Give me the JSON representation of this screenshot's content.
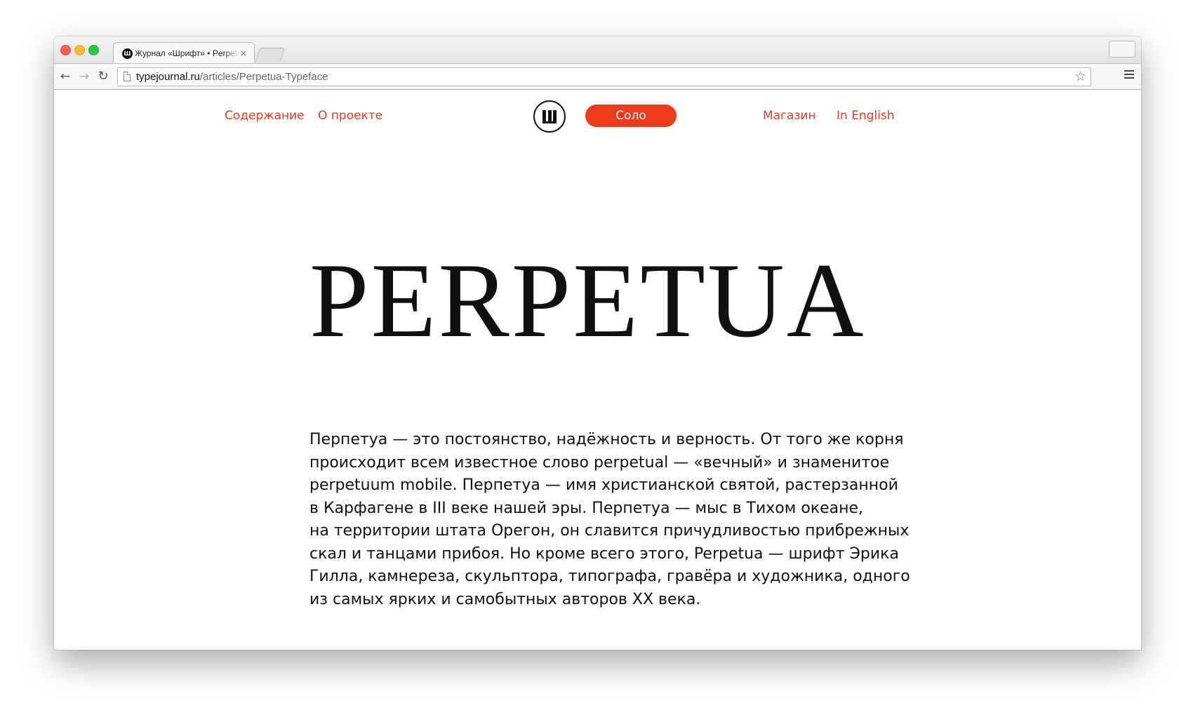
{
  "browser": {
    "tab": {
      "favicon_glyph": "Ш",
      "title": "Журнал «Шрифт» • Perpetua Typeface",
      "close_glyph": "×"
    },
    "nav": {
      "back_glyph": "←",
      "forward_glyph": "→",
      "reload_glyph": "↻"
    },
    "address": {
      "domain": "typejournal.ru",
      "path": "/articles/Perpetua-Typeface"
    },
    "bookmark_glyph": "☆",
    "icons": [
      "page-icon",
      "star-icon",
      "menu-icon",
      "back-icon",
      "forward-icon",
      "reload-icon",
      "close-icon"
    ],
    "traffic_colors": [
      "#fc5f57",
      "#fdbc2e",
      "#28c840"
    ]
  },
  "site": {
    "accent_color": "#ef3a1c",
    "nav_left": [
      "Содержание",
      "О проекте"
    ],
    "solo_label": "Соло",
    "nav_right": [
      "Магазин",
      "In English"
    ]
  },
  "article": {
    "title": "PERPETUA",
    "intro_lines": [
      "Перпетуа — это постоянство, надёжность и верность. От того же корня",
      "происходит всем известное слово perpetual — «вечный» и знаменитое",
      "perpetuum mobile. Перпетуа — имя христианской святой, растерзанной",
      "в Карфагене в III веке нашей эры. Перпетуа — мыс в Тихом океане,",
      "на территории штата Орегон, он славится причудливостью прибрежных",
      "скал и танцами прибоя. Но кроме всего этого, Perpetua — шрифт Эрика",
      "Гилла, камнереза, скульптора, типографа, гравёра и художника, одного",
      "из самых ярких и самобытных авторов XX века."
    ]
  }
}
